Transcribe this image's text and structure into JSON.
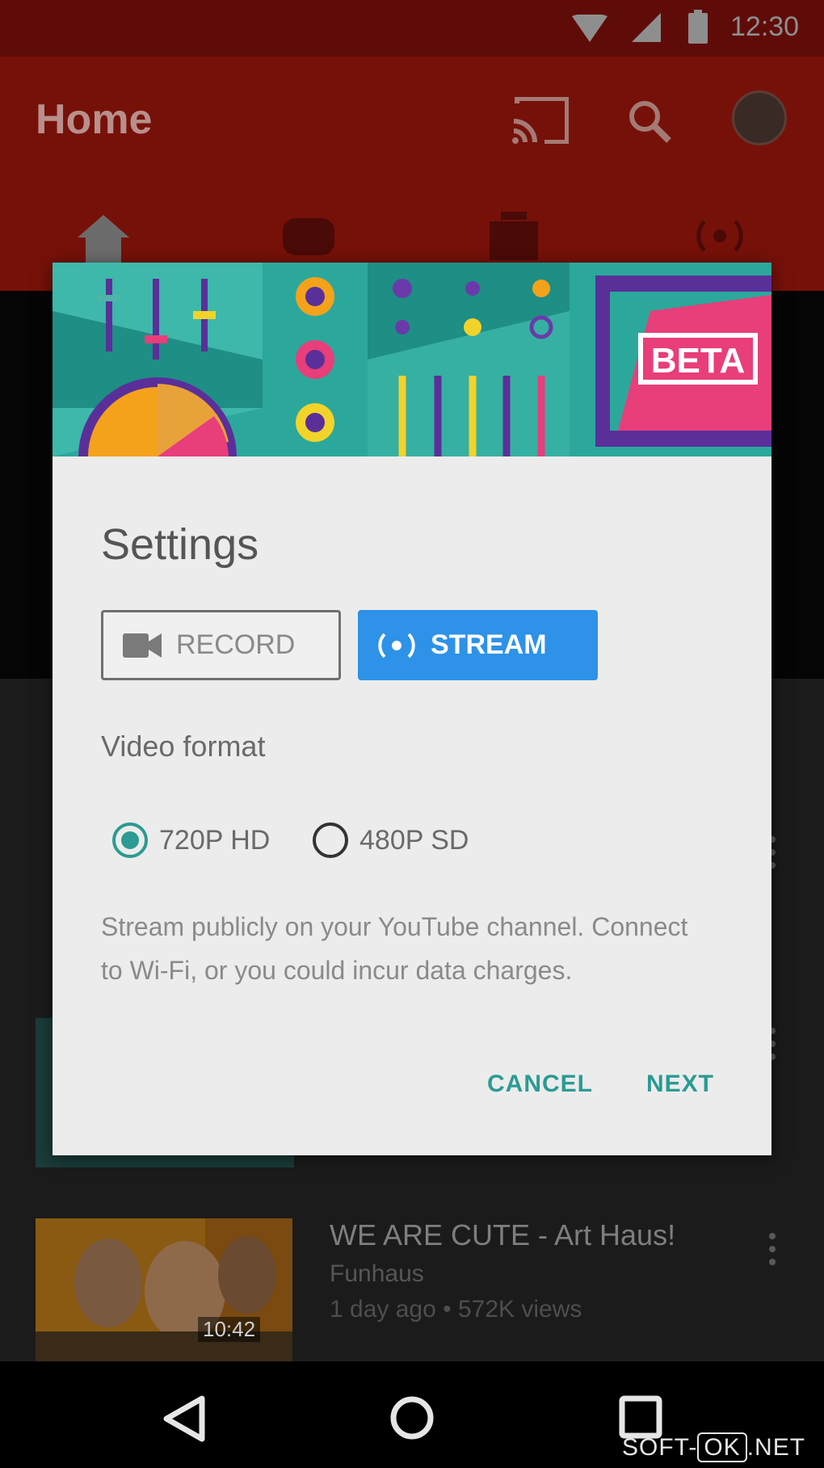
{
  "status_bar": {
    "time": "12:30",
    "icons": [
      "wifi-icon",
      "signal-icon",
      "battery-icon"
    ]
  },
  "app_bar": {
    "title": "Home",
    "actions": [
      "cast-icon",
      "search-icon",
      "avatar"
    ],
    "tabs": [
      "home-icon",
      "gaming-icon",
      "subscriptions-icon",
      "live-icon"
    ]
  },
  "background_video": {
    "title": "WE ARE CUTE - Art Haus!",
    "channel": "Funhaus",
    "meta": "1 day ago • 572K views",
    "duration": "10:42"
  },
  "dialog": {
    "banner_badge": "BETA",
    "title": "Settings",
    "mode_buttons": {
      "record": {
        "label": "RECORD",
        "icon": "videocam-icon",
        "selected": false
      },
      "stream": {
        "label": "STREAM",
        "icon": "stream-icon",
        "selected": true
      }
    },
    "video_format_label": "Video format",
    "formats": [
      {
        "label": "720P HD",
        "checked": true
      },
      {
        "label": "480P SD",
        "checked": false
      }
    ],
    "description": "Stream publicly on your YouTube channel. Connect to Wi-Fi, or you could incur data charges.",
    "actions": {
      "cancel": "CANCEL",
      "next": "NEXT"
    }
  },
  "nav_bar": [
    "back-icon",
    "home-circle-icon",
    "recents-icon"
  ],
  "watermark": {
    "left": "SOFT-",
    "boxed": "OK",
    "right": ".NET"
  },
  "colors": {
    "accent": "#2b9b93",
    "stream_button": "#2d92e8",
    "app_bar": "#761109",
    "banner_teal": "#2ba89b",
    "banner_pink": "#e83e7a",
    "banner_purple": "#5a2f9a"
  }
}
